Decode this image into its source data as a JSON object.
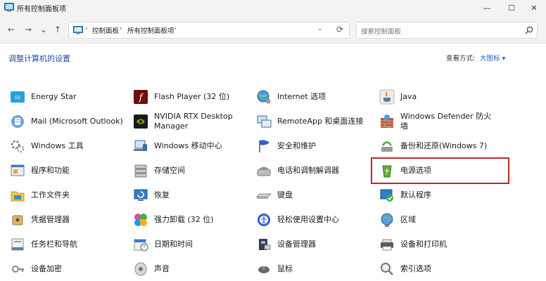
{
  "window": {
    "title": "所有控制面板项",
    "minimize": "—",
    "maximize": "☐",
    "close": "✕"
  },
  "nav": {
    "back": "←",
    "forward": "→",
    "recent": "⌄",
    "up": "↑",
    "breadcrumbs": [
      "控制面板",
      "所有控制面板项"
    ],
    "separator": "›",
    "dropdown": "⌄",
    "refresh": "⟳",
    "search_placeholder": "搜索控制面板"
  },
  "heading": "调整计算机的设置",
  "view": {
    "label": "查看方式:",
    "value": "大图标 ▾"
  },
  "columns": [
    [
      {
        "label": "Energy Star",
        "icon": "energy-star-icon"
      },
      {
        "label": "Mail (Microsoft Outlook)",
        "icon": "mail-icon"
      },
      {
        "label": "Windows 工具",
        "icon": "windows-tools-icon"
      },
      {
        "label": "程序和功能",
        "icon": "programs-features-icon"
      },
      {
        "label": "工作文件夹",
        "icon": "work-folders-icon"
      },
      {
        "label": "凭据管理器",
        "icon": "credential-manager-icon"
      },
      {
        "label": "任务栏和导航",
        "icon": "taskbar-icon"
      },
      {
        "label": "设备加密",
        "icon": "device-encryption-icon"
      }
    ],
    [
      {
        "label": "Flash Player (32 位)",
        "icon": "flash-player-icon"
      },
      {
        "label": "NVIDIA RTX Desktop Manager",
        "icon": "nvidia-icon"
      },
      {
        "label": "Windows 移动中心",
        "icon": "mobility-center-icon"
      },
      {
        "label": "存储空间",
        "icon": "storage-spaces-icon"
      },
      {
        "label": "恢复",
        "icon": "recovery-icon"
      },
      {
        "label": "强力卸载 (32 位)",
        "icon": "uninstaller-icon"
      },
      {
        "label": "日期和时间",
        "icon": "date-time-icon"
      },
      {
        "label": "声音",
        "icon": "sound-icon"
      }
    ],
    [
      {
        "label": "Internet 选项",
        "icon": "internet-options-icon"
      },
      {
        "label": "RemoteApp 和桌面连接",
        "icon": "remoteapp-icon"
      },
      {
        "label": "安全和维护",
        "icon": "security-maintenance-icon"
      },
      {
        "label": "电话和调制解调器",
        "icon": "phone-modem-icon"
      },
      {
        "label": "键盘",
        "icon": "keyboard-icon"
      },
      {
        "label": "轻松使用设置中心",
        "icon": "ease-of-access-icon"
      },
      {
        "label": "设备管理器",
        "icon": "device-manager-icon"
      },
      {
        "label": "鼠标",
        "icon": "mouse-icon"
      }
    ],
    [
      {
        "label": "Java",
        "icon": "java-icon"
      },
      {
        "label": "Windows Defender 防火墙",
        "icon": "firewall-icon"
      },
      {
        "label": "备份和还原(Windows 7)",
        "icon": "backup-restore-icon"
      },
      {
        "label": "电源选项",
        "icon": "power-options-icon"
      },
      {
        "label": "默认程序",
        "icon": "default-programs-icon"
      },
      {
        "label": "区域",
        "icon": "region-icon"
      },
      {
        "label": "设备和打印机",
        "icon": "devices-printers-icon"
      },
      {
        "label": "索引选项",
        "icon": "indexing-options-icon"
      }
    ]
  ],
  "highlight_color": "#c0262d"
}
